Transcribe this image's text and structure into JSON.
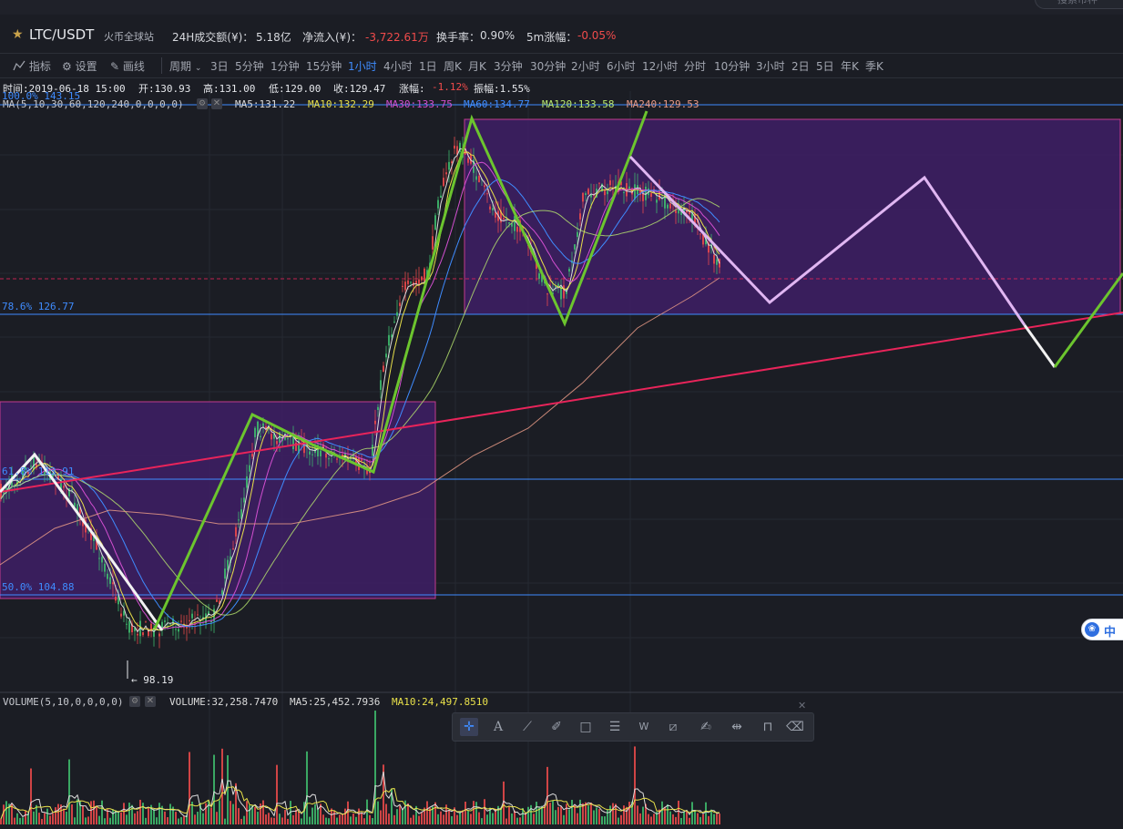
{
  "search": {
    "placeholder": "搜索币种"
  },
  "header": {
    "pair": "LTC/USDT",
    "exchange": "火币全球站",
    "vol24h_label": "24H成交额(¥)：",
    "vol24h_value": "5.18亿",
    "netflow_label": "净流入(¥)：",
    "netflow_value": "-3,722.61万",
    "turnover_label": "换手率：",
    "turnover_value": "0.90%",
    "change5m_label": "5m涨幅：",
    "change5m_value": "-0.05%"
  },
  "toolbar": {
    "indicator": "指标",
    "settings": "设置",
    "draw": "画线",
    "period": "周期",
    "periods": [
      "3日",
      "5分钟",
      "1分钟",
      "15分钟",
      "1小时",
      "4小时",
      "1日",
      "周K",
      "月K",
      "3分钟",
      "30分钟",
      "2小时",
      "6小时",
      "12小时",
      "分时",
      "10分钟",
      "3小时",
      "2日",
      "5日",
      "年K",
      "季K"
    ],
    "active_period": "1小时"
  },
  "legend": {
    "time": "时间:2019-06-18 15:00",
    "open": "开:130.93",
    "high": "高:131.00",
    "low": "低:129.00",
    "close": "收:129.47",
    "chg_label": "涨幅:",
    "chg_value": "-1.12%",
    "amp": "振幅:1.55%",
    "ma_def": "MA(5,10,30,60,120,240,0,0,0,0)",
    "ma5": "MA5:131.22",
    "ma10": "MA10:132.29",
    "ma30": "MA30:133.75",
    "ma60": "MA60:134.77",
    "ma120": "MA120:133.58",
    "ma240": "MA240:129.53"
  },
  "fib": {
    "f100": "100.0% 143.15",
    "f786": "78.6% 126.77",
    "f618": "61.8% 113.91",
    "f500": "50.0% 104.88"
  },
  "low_marker": "← 98.19",
  "volume": {
    "def": "VOLUME(5,10,0,0,0,0)",
    "volume": "VOLUME:32,258.7470",
    "ma5": "MA5:25,452.7936",
    "ma10": "MA10:24,497.8510"
  },
  "badge": {
    "text": "中"
  },
  "colors": {
    "up": "#3fbf6f",
    "down": "#f04b4b",
    "accent": "#3f8cff",
    "zone_fill": "#3e1f66",
    "zone_border": "#c23a8e",
    "trend": "#e8245a",
    "zigzag_green": "#6cc52e",
    "zigzag_white": "#f2f2f2",
    "projection": "#e0b6f2"
  },
  "icons": [
    "star-icon",
    "indicator-icon",
    "settings-icon",
    "draw-icon",
    "crosshair-icon",
    "text-icon",
    "line-icon",
    "pen-icon",
    "rect-icon",
    "fib-icon",
    "wave-icon",
    "ruler-icon",
    "brush-icon",
    "range-icon",
    "lock-icon",
    "trash-icon",
    "close-icon"
  ]
}
